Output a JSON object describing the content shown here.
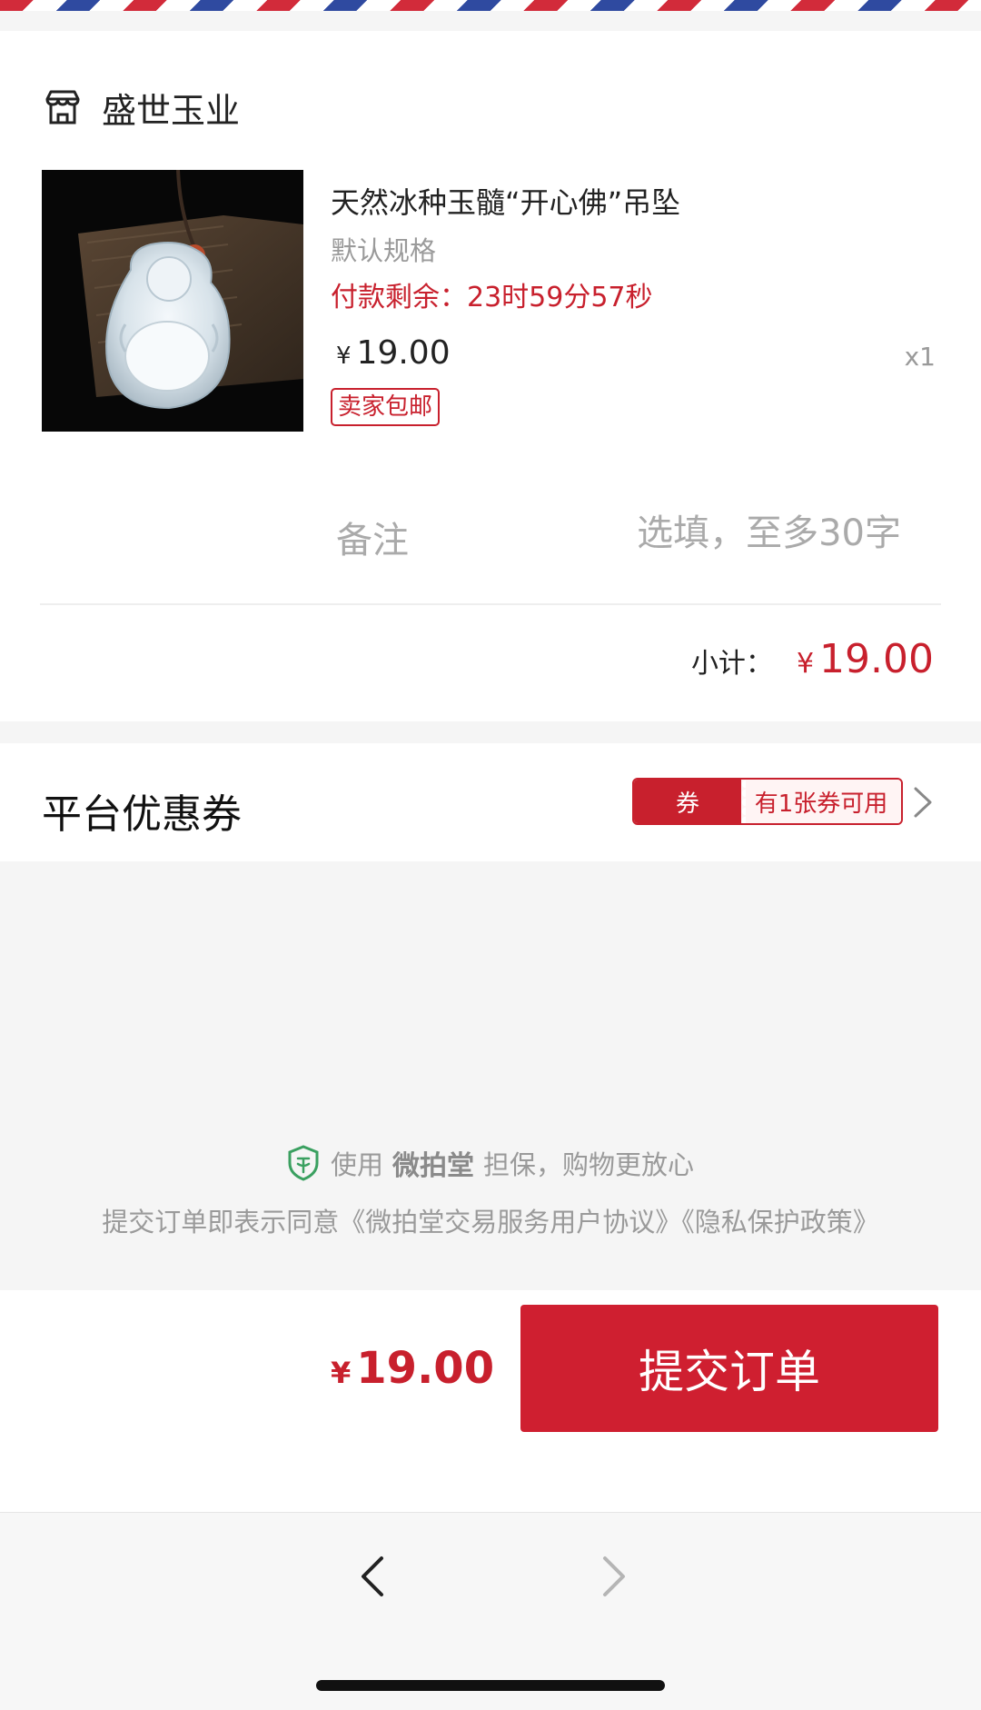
{
  "shop": {
    "name": "盛世玉业",
    "icon": "shop-icon"
  },
  "product": {
    "title": "天然冰种玉髓“开心佛”吊坠",
    "spec": "默认规格",
    "countdown_label": "付款剩余：",
    "countdown_value": "23时59分57秒",
    "currency": "¥",
    "price": "19.00",
    "quantity": "x1",
    "shipping_badge": "卖家包邮"
  },
  "remark": {
    "label": "备注",
    "placeholder": "选填，至多30字",
    "value": ""
  },
  "subtotal": {
    "label": "小计：",
    "currency": "¥",
    "amount": "19.00"
  },
  "coupon": {
    "title": "平台优惠券",
    "tag_left": "券",
    "tag_right": "有1张券可用"
  },
  "footer": {
    "guarantee_prefix": "使用",
    "guarantee_brand": "微拍堂",
    "guarantee_suffix": "担保，购物更放心",
    "agreement": "提交订单即表示同意《微拍堂交易服务用户协议》《隐私保护政策》"
  },
  "checkout": {
    "currency": "¥",
    "total": "19.00",
    "submit_label": "提交订单"
  },
  "colors": {
    "accent": "#cf1f30",
    "muted": "#9a9a9a",
    "background": "#f5f5f5"
  }
}
